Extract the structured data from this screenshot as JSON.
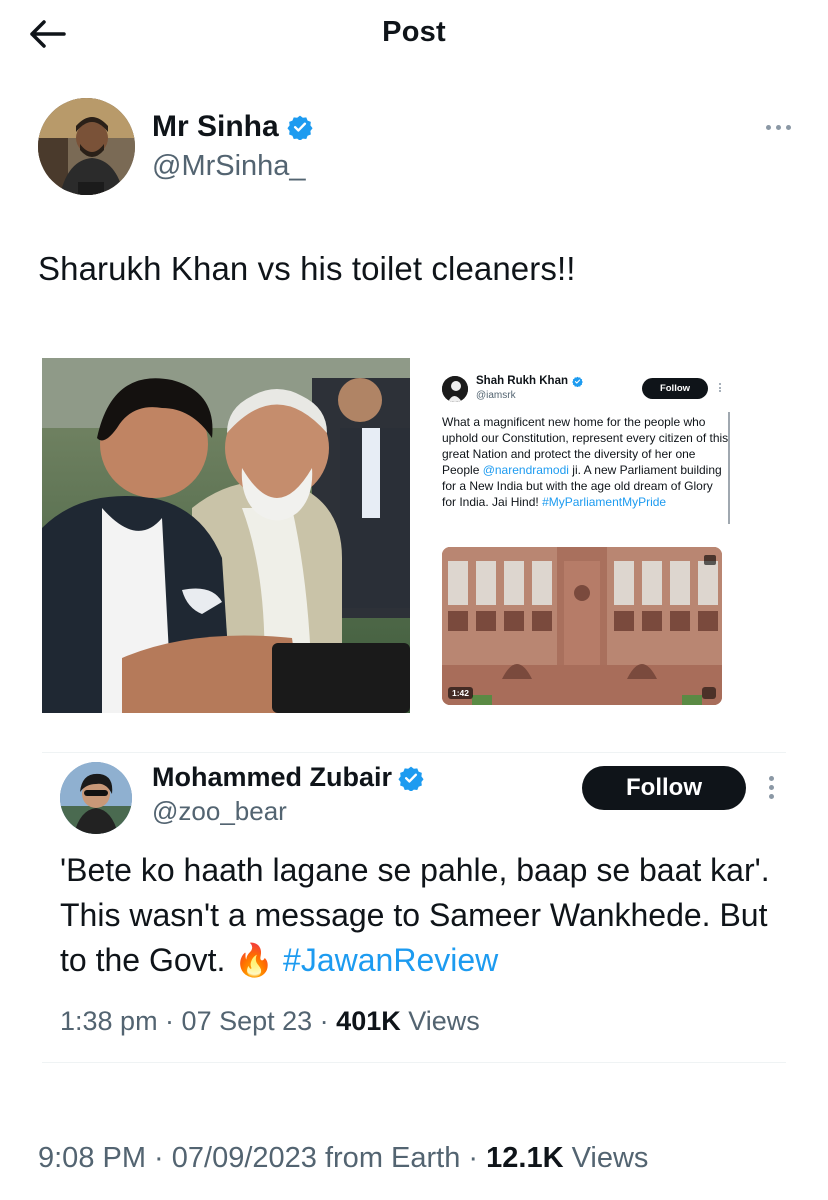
{
  "header": {
    "title": "Post",
    "back_icon": "arrow-left-icon"
  },
  "post": {
    "author_name": "Mr Sinha",
    "author_handle": "@MrSinha_",
    "verified": true,
    "text": "Sharukh Khan vs his toilet cleaners!!",
    "timestamp": "9:08 PM · 07/09/2023 from Earth · ",
    "views_count": "12.1K",
    "views_label": " Views"
  },
  "embedded_tweet": {
    "author_name": "Shah Rukh Khan",
    "author_handle": "@iamsrk",
    "follow_label": "Follow",
    "text_1": "What a magnificent new home for the people who uphold our Constitution, represent every citizen of this great Nation and protect the diversity of her one People ",
    "mention": "@narendramodi",
    "text_2": " ji. A new Parliament building for a New India but with the age old dream of Glory for India. Jai Hind! ",
    "hashtag": "#MyParliamentMyPride",
    "video_duration": "1:42"
  },
  "quoted_post": {
    "author_name": "Mohammed Zubair",
    "author_handle": "@zoo_bear",
    "follow_label": "Follow",
    "text_1": "'Bete ko haath lagane se pahle, baap se baat kar'. This wasn't a message to Sameer Wankhede. But to the Govt. ",
    "emoji": "🔥",
    "hashtag": "#JawanReview",
    "meta_time": "1:38 pm · 07 Sept 23 · ",
    "views_count": "401K",
    "views_label": " Views"
  },
  "colors": {
    "accent": "#1d9bf0",
    "text": "#0f1419",
    "secondary": "#536471",
    "button_bg": "#0f1419"
  }
}
